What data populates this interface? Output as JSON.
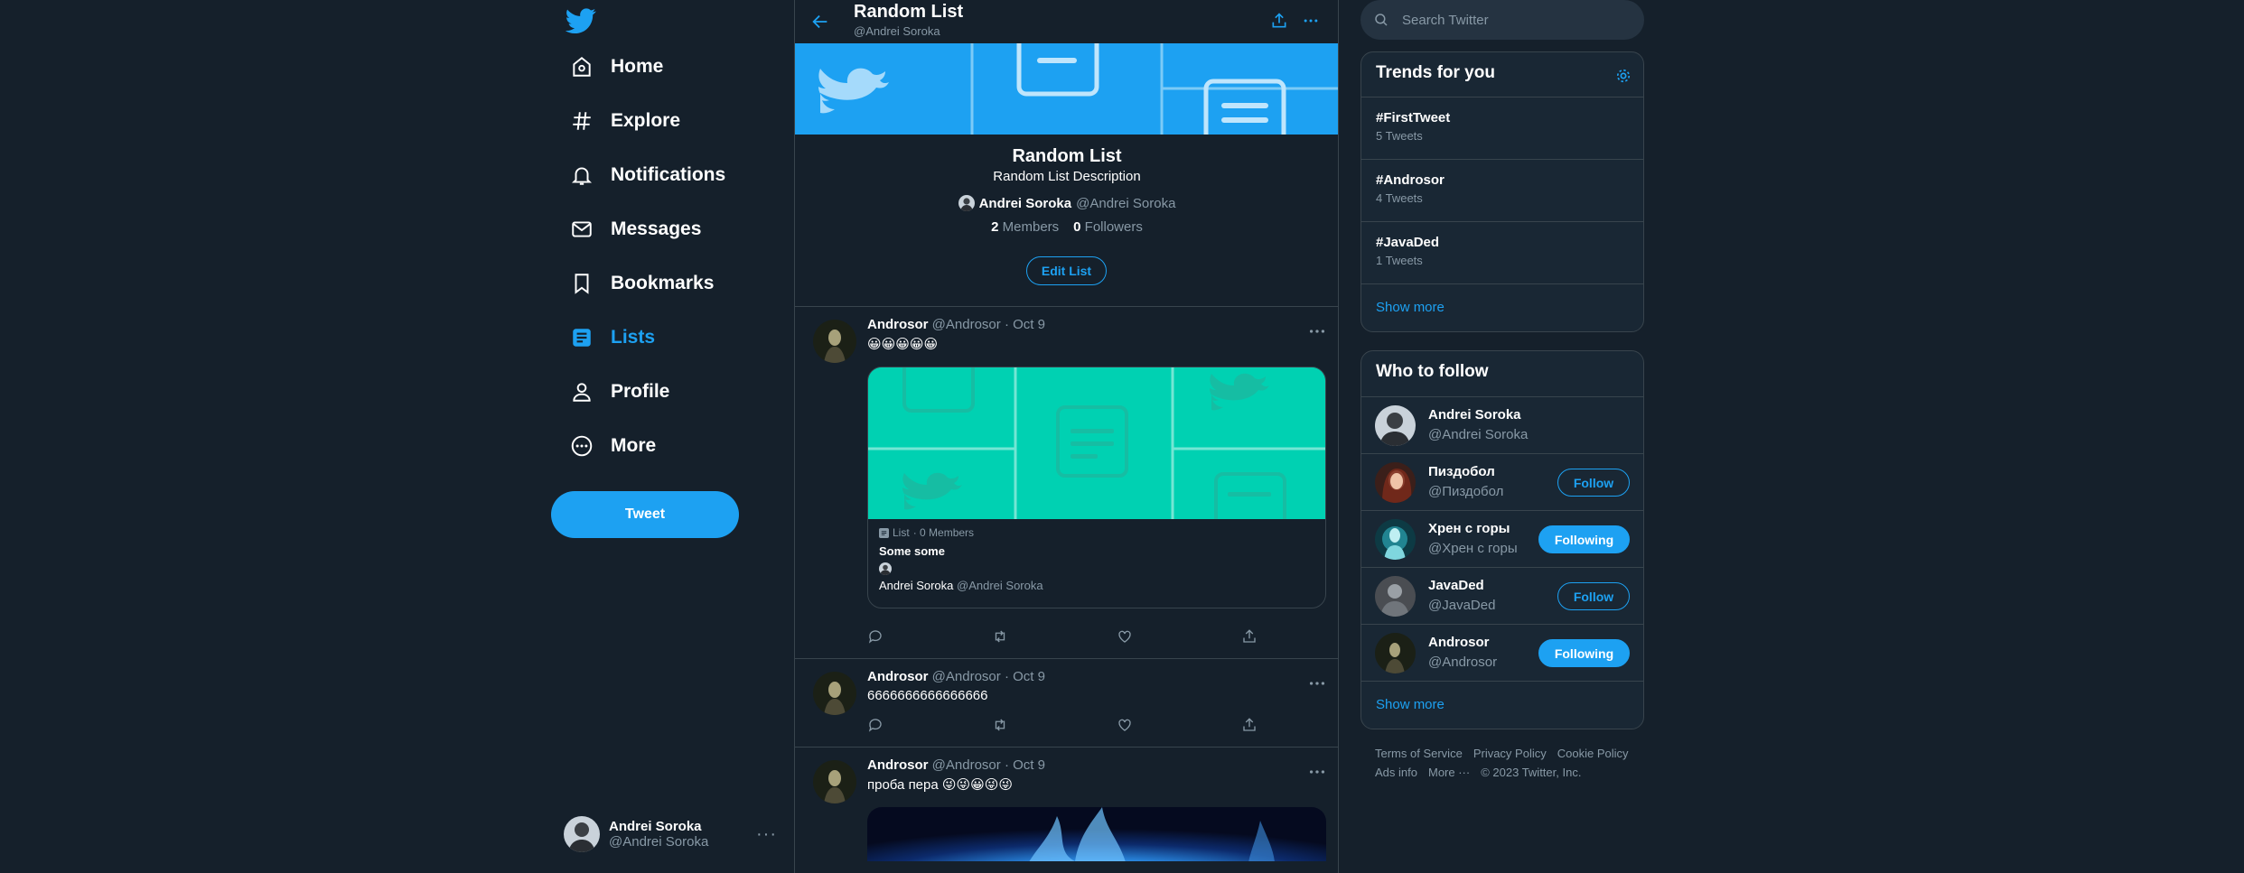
{
  "sidebar": {
    "nav": [
      {
        "label": "Home",
        "icon": "home-icon"
      },
      {
        "label": "Explore",
        "icon": "hashtag-icon"
      },
      {
        "label": "Notifications",
        "icon": "bell-icon"
      },
      {
        "label": "Messages",
        "icon": "envelope-icon"
      },
      {
        "label": "Bookmarks",
        "icon": "bookmark-icon"
      },
      {
        "label": "Lists",
        "icon": "list-icon"
      },
      {
        "label": "Profile",
        "icon": "person-icon"
      },
      {
        "label": "More",
        "icon": "more-circle-icon"
      }
    ],
    "active": "Lists",
    "tweet_button": "Tweet",
    "account": {
      "name": "Andrei Soroka",
      "handle": "@Andrei Soroka"
    }
  },
  "header": {
    "title": "Random List",
    "subtitle": "@Andrei Soroka"
  },
  "list": {
    "name": "Random List",
    "description": "Random List Description",
    "owner_name": "Andrei Soroka",
    "owner_handle": "@Andrei Soroka",
    "members_count": "2",
    "members_label": "Members",
    "followers_count": "0",
    "followers_label": "Followers",
    "edit_button": "Edit List"
  },
  "tweets": [
    {
      "name": "Androsor",
      "handle": "@Androsor",
      "date": "· Oct 9",
      "text": "😀😀😀😀😀",
      "card": {
        "type_label": "List",
        "members": "· 0 Members",
        "name": "Some some",
        "owner_name": "Andrei Soroka",
        "owner_handle": "@Andrei Soroka"
      }
    },
    {
      "name": "Androsor",
      "handle": "@Androsor",
      "date": "· Oct 9",
      "text": "6666666666666666"
    },
    {
      "name": "Androsor",
      "handle": "@Androsor",
      "date": "· Oct 9",
      "text": "проба пера 😜😜😀😜😜"
    }
  ],
  "search": {
    "placeholder": "Search Twitter"
  },
  "trends": {
    "title": "Trends for you",
    "items": [
      {
        "name": "#FirstTweet",
        "count": "5 Tweets"
      },
      {
        "name": "#Androsor",
        "count": "4 Tweets"
      },
      {
        "name": "#JavaDed",
        "count": "1 Tweets"
      }
    ],
    "show_more": "Show more"
  },
  "who_to_follow": {
    "title": "Who to follow",
    "users": [
      {
        "name": "Andrei Soroka",
        "handle": "@Andrei Soroka",
        "button": ""
      },
      {
        "name": "Пиздобол",
        "handle": "@Пиздобол",
        "button": "Follow"
      },
      {
        "name": "Хрен с горы",
        "handle": "@Хрен с горы",
        "button": "Following"
      },
      {
        "name": "JavaDed",
        "handle": "@JavaDed",
        "button": "Follow"
      },
      {
        "name": "Androsor",
        "handle": "@Androsor",
        "button": "Following"
      }
    ],
    "show_more": "Show more"
  },
  "footer": {
    "links": [
      "Terms of Service",
      "Privacy Policy",
      "Cookie Policy",
      "Ads info",
      "More ···"
    ],
    "copyright": "© 2023 Twitter, Inc."
  },
  "colors": {
    "background": "#15202b",
    "panel": "#192734",
    "accent": "#1da1f2",
    "border": "#38444d",
    "muted": "#8899a6",
    "card_image": "#00d1b2"
  }
}
